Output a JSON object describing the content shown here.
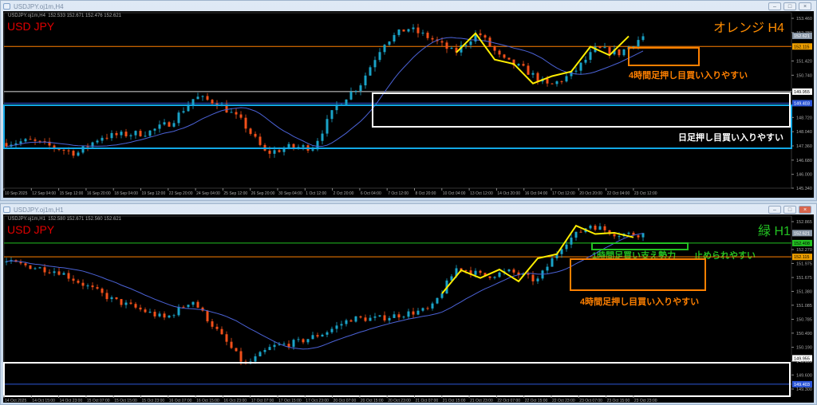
{
  "colors": {
    "up": "#1aa3c7",
    "down": "#f2501a",
    "ma": "#4b62d6",
    "zigzag": "#ffee00",
    "orange": "#ff8000",
    "cyan": "#12a8e6",
    "green": "#22c022",
    "white": "#ffffff",
    "blue": "#2c56d8"
  },
  "top": {
    "window_title": "USDJPY.oj1m,H4",
    "header": "USDJPY.oj1m,H4  152.533 152.671 152.476 152.621",
    "symbol": "USD JPY",
    "label": "オレンジ H4",
    "annot_4h": "4時間足押し目買い入りやすい",
    "annot_daily": "日足押し目買い入りやすい",
    "price_ticks": [
      "153.460",
      "152.780",
      "151.420",
      "150.740",
      "148.720",
      "148.040",
      "147.360",
      "146.680",
      "146.000",
      "145.340"
    ],
    "price_tags": [
      {
        "value": "152.621",
        "kind": "current"
      },
      {
        "value": "152.115",
        "kind": "orange"
      },
      {
        "value": "149.955",
        "kind": "white"
      },
      {
        "value": "149.403",
        "kind": "blue"
      }
    ],
    "time_labels": [
      "10 Sep 2025",
      "12 Sep 04:00",
      "15 Sep 12:00",
      "16 Sep 20:00",
      "18 Sep 04:00",
      "19 Sep 12:00",
      "22 Sep 20:00",
      "24 Sep 04:00",
      "25 Sep 12:00",
      "26 Sep 20:00",
      "30 Sep 04:00",
      "1 Oct 12:00",
      "2 Oct 20:00",
      "6 Oct 04:00",
      "7 Oct 12:00",
      "8 Oct 20:00",
      "10 Oct 04:00",
      "13 Oct 12:00",
      "14 Oct 20:00",
      "16 Oct 04:00",
      "17 Oct 12:00",
      "20 Oct 20:00",
      "22 Oct 04:00",
      "23 Oct 12:00"
    ],
    "price_path": [
      147.5,
      147.6,
      147.3,
      147.0,
      147.8,
      147.9,
      148.0,
      148.5,
      149.7,
      149.4,
      148.5,
      147.0,
      147.3,
      147.3,
      149.3,
      150.3,
      152.3,
      153.0,
      152.5,
      151.8,
      152.8,
      151.5,
      151.0,
      150.2,
      150.8,
      152.0,
      151.8,
      152.6
    ]
  },
  "bottom": {
    "window_title": "USDJPY.oj1m,H1",
    "header": "USDJPY.oj1m,H1  152.580 152.671 152.560 152.621",
    "symbol": "USD JPY",
    "label": "緑 H1",
    "annot_support": "1時間足買い支え勢力",
    "annot_stop": "止められやすい",
    "annot_4h": "4時間足押し目買い入りやすい",
    "price_ticks": [
      "152.865",
      "152.270",
      "151.975",
      "151.675",
      "151.380",
      "151.085",
      "150.785",
      "150.490",
      "150.190",
      "149.895",
      "149.600",
      "149.300"
    ],
    "price_tags": [
      {
        "value": "152.621",
        "kind": "current"
      },
      {
        "value": "152.408",
        "kind": "green"
      },
      {
        "value": "152.115",
        "kind": "orange"
      },
      {
        "value": "149.955",
        "kind": "white"
      },
      {
        "value": "149.403",
        "kind": "blue"
      }
    ],
    "time_labels": [
      "14 Oct 2025",
      "14 Oct 15:00",
      "14 Oct 23:00",
      "15 Oct 07:00",
      "15 Oct 15:00",
      "15 Oct 23:00",
      "16 Oct 07:00",
      "16 Oct 15:00",
      "16 Oct 23:00",
      "17 Oct 07:00",
      "17 Oct 15:00",
      "17 Oct 23:00",
      "20 Oct 07:00",
      "20 Oct 15:00",
      "20 Oct 23:00",
      "21 Oct 07:00",
      "21 Oct 15:00",
      "21 Oct 23:00",
      "22 Oct 07:00",
      "22 Oct 15:00",
      "22 Oct 23:00",
      "23 Oct 07:00",
      "23 Oct 15:00",
      "23 Oct 23:00"
    ],
    "price_path": [
      152.0,
      151.9,
      151.8,
      151.5,
      151.2,
      151.0,
      150.8,
      151.2,
      150.5,
      149.8,
      150.2,
      150.3,
      150.5,
      150.8,
      150.8,
      150.9,
      151.0,
      151.9,
      151.7,
      151.8,
      151.6,
      152.4,
      152.8,
      152.6,
      152.6
    ]
  }
}
